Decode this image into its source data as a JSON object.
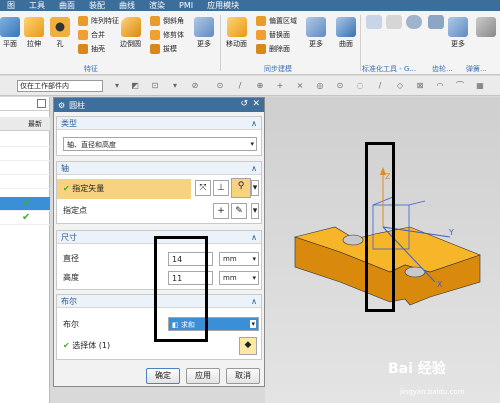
{
  "ribbon": {
    "tabs": [
      "图",
      "工具",
      "曲面",
      "装配",
      "曲线",
      "渲染",
      "PMI",
      "应用模块"
    ],
    "buttons": {
      "plane": "平面",
      "extrude": "拉伸",
      "hole": "孔",
      "pattern_feature": "阵列特征",
      "unite": "合并",
      "shell": "抽壳",
      "edge_blend": "边倒圆",
      "chamfer": "倒斜角",
      "trim_body": "修剪体",
      "draft": "拔模",
      "more1": "更多",
      "move_face": "移动面",
      "offset_region": "偏置区域",
      "replace_face": "替换面",
      "delete_face": "删除面",
      "more2": "更多",
      "surface": "曲面",
      "more3": "更多"
    },
    "group_labels": {
      "feature": "特征",
      "sync_modeling": "同步建模",
      "standard_tools": "标准化工具 - G...",
      "gear": "齿轮...",
      "spring": "弹簧..."
    }
  },
  "toolbar": {
    "filter": "仅在工作部件内"
  },
  "navigator": {
    "column_header": "最新"
  },
  "dialog": {
    "title": "圆柱",
    "type": {
      "header": "类型",
      "value": "轴、直径和高度"
    },
    "axis": {
      "header": "轴",
      "specify_vector": "指定矢量",
      "specify_point": "指定点"
    },
    "size": {
      "header": "尺寸",
      "diameter_label": "直径",
      "diameter_value": "14",
      "diameter_unit": "mm",
      "height_label": "高度",
      "height_value": "11",
      "height_unit": "mm"
    },
    "boolean": {
      "header": "布尔",
      "label": "布尔",
      "value": "求和",
      "select_body": "选择体 (1)"
    },
    "buttons": {
      "ok": "确定",
      "apply": "应用",
      "cancel": "取消"
    }
  },
  "axes": {
    "x": "X",
    "y": "Y",
    "z": "Z"
  },
  "watermark": {
    "logo": "Bai 经验",
    "url": "jingyan.baidu.com"
  },
  "colors": {
    "title_bar": "#3f6e9b",
    "accent_blue": "#2a5b93",
    "part_yellow": "#f5a81c",
    "highlight": "#f7d280",
    "check_green": "#3fae2a"
  }
}
